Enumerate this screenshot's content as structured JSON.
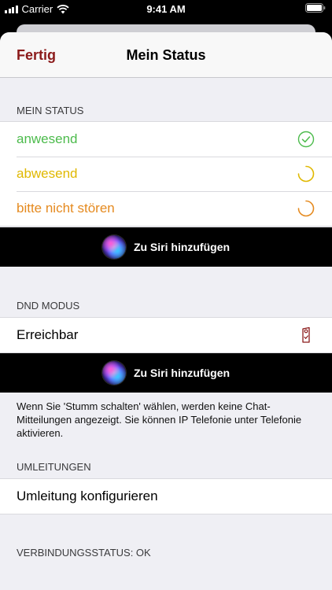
{
  "status_bar": {
    "carrier": "Carrier",
    "time": "9:41 AM"
  },
  "nav": {
    "done": "Fertig",
    "title": "Mein Status"
  },
  "sections": {
    "status_header": "MEIN STATUS",
    "status_rows": [
      {
        "label": "anwesend",
        "color": "#4cbb4c"
      },
      {
        "label": "abwesend",
        "color": "#e0b800"
      },
      {
        "label": "bitte nicht stören",
        "color": "#e58a1f"
      }
    ],
    "siri_label": "Zu Siri hinzufügen",
    "dnd_header": "DND MODUS",
    "dnd_row": "Erreichbar",
    "dnd_footer": "Wenn Sie 'Stumm schalten' wählen, werden keine Chat-Mitteilungen angezeigt. Sie können IP Telefonie unter Telefonie aktivieren.",
    "redirect_header": "UMLEITUNGEN",
    "redirect_row": "Umleitung konfigurieren",
    "connection_status": "VERBINDUNGSSTATUS: OK"
  },
  "colors": {
    "accent": "#8b1a1a",
    "background": "#efeff4"
  }
}
